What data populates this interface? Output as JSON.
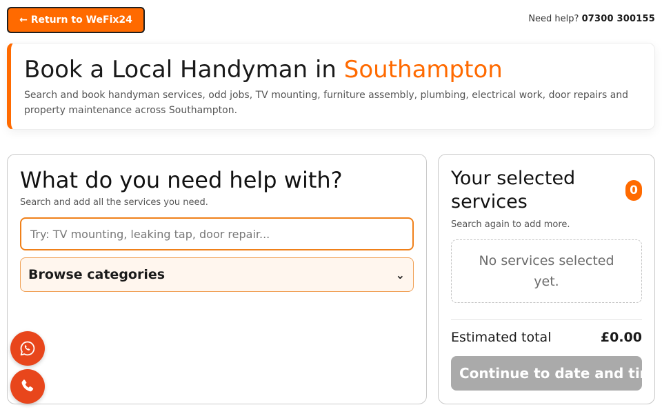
{
  "topbar": {
    "return_label": "← Return to WeFix24",
    "help_text": "Need help?",
    "help_phone": "07300 300155"
  },
  "hero": {
    "title_prefix": "Book a Local Handyman in",
    "city": "Southampton",
    "description": "Search and book handyman services, odd jobs, TV mounting, furniture assembly, plumbing, electrical work, door repairs and property maintenance across Southampton."
  },
  "search_panel": {
    "heading": "What do you need help with?",
    "subheading": "Search and add all the services you need.",
    "search_placeholder": "Try: TV mounting, leaking tap, door repair...",
    "search_value": "",
    "browse_label": "Browse categories",
    "browse_chevron": "⌄"
  },
  "selection_panel": {
    "heading": "Your selected services",
    "count": "0",
    "subheading": "Search again to add more.",
    "empty_message": "No services selected yet.",
    "total_label": "Estimated total",
    "total_value": "£0.00",
    "continue_label": "Continue to date and time"
  },
  "floating": {
    "whatsapp_icon": "whatsapp-icon",
    "phone_icon": "phone-icon"
  },
  "colors": {
    "accent": "#ff6a00",
    "fab": "#e8461c",
    "disabled_button": "#aaaaaa"
  }
}
